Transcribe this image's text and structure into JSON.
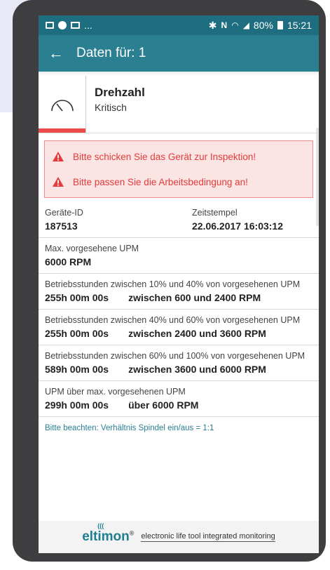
{
  "statusbar": {
    "left_extra": "...",
    "battery": "80%",
    "time": "15:21"
  },
  "appbar": {
    "title": "Daten für: 1"
  },
  "header": {
    "title": "Drehzahl",
    "subtitle": "Kritisch"
  },
  "alerts": [
    {
      "text": "Bitte schicken Sie das Gerät zur Inspektion!"
    },
    {
      "text": "Bitte passen Sie die Arbeitsbedingung an!"
    }
  ],
  "device": {
    "id_label": "Geräte-ID",
    "id_value": "187513",
    "time_label": "Zeitstempel",
    "time_value": "22.06.2017 16:03:12"
  },
  "max_rpm": {
    "label": "Max. vorgesehene UPM",
    "value": "6000 RPM"
  },
  "bands": [
    {
      "label": "Betriebsstunden zwischen 10% und 40% von vorgesehenen UPM",
      "hours": "255h 00m 00s",
      "range": "zwischen 600 und 2400 RPM"
    },
    {
      "label": "Betriebsstunden zwischen 40% und 60% von vorgesehenen UPM",
      "hours": "255h 00m 00s",
      "range": "zwischen 2400 und 3600 RPM"
    },
    {
      "label": "Betriebsstunden zwischen 60% und 100% von vorgesehenen UPM",
      "hours": "589h 00m 00s",
      "range": "zwischen 3600 und 6000 RPM"
    }
  ],
  "over_max": {
    "label": "UPM über max. vorgesehenen UPM",
    "hours": "299h 00m 00s",
    "range": "über 6000 RPM"
  },
  "note": "Bitte beachten: Verhältnis Spindel ein/aus = 1:1",
  "footer": {
    "logo": "eltimon",
    "reg": "®",
    "tagline": "electronic life tool integrated monitoring"
  },
  "colors": {
    "statusbar": "#1f6e80",
    "appbar": "#2a7f91",
    "alert_red": "#e23c3c",
    "critical_bar": "#ec4a4a"
  }
}
